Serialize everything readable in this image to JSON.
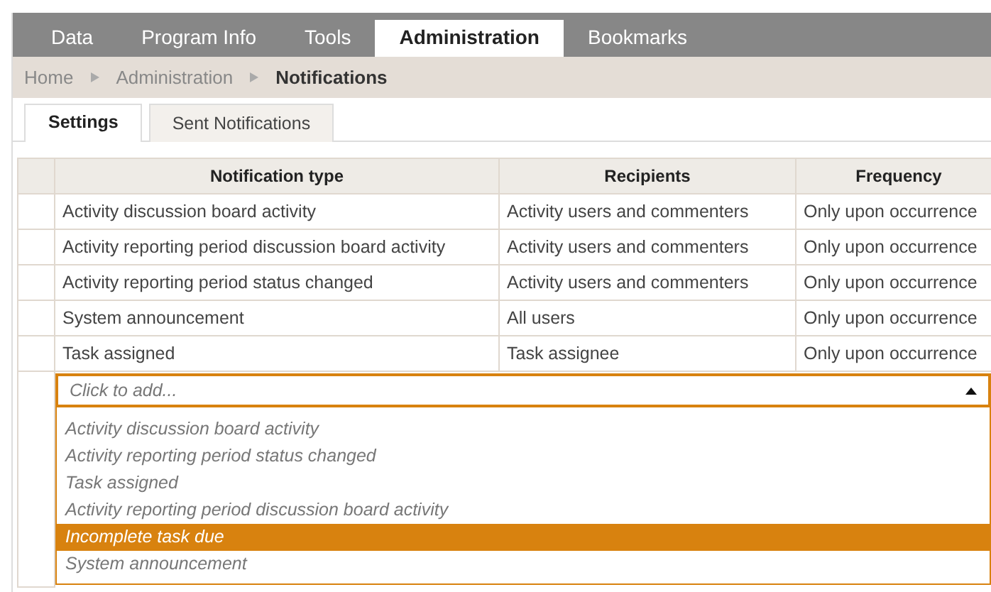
{
  "nav_tabs": [
    {
      "label": "Data",
      "selected": false
    },
    {
      "label": "Program Info",
      "selected": false
    },
    {
      "label": "Tools",
      "selected": false
    },
    {
      "label": "Administration",
      "selected": true
    },
    {
      "label": "Bookmarks",
      "selected": false
    }
  ],
  "breadcrumb": [
    {
      "label": "Home",
      "current": false
    },
    {
      "label": "Administration",
      "current": false
    },
    {
      "label": "Notifications",
      "current": true
    }
  ],
  "sub_tabs": [
    {
      "label": "Settings",
      "selected": true
    },
    {
      "label": "Sent Notifications",
      "selected": false
    }
  ],
  "table": {
    "columns": [
      "Notification type",
      "Recipients",
      "Frequency"
    ],
    "rows": [
      [
        "Activity discussion board activity",
        "Activity users and commenters",
        "Only upon occurrence"
      ],
      [
        "Activity reporting period discussion board activity",
        "Activity users and commenters",
        "Only upon occurrence"
      ],
      [
        "Activity reporting period status changed",
        "Activity users and commenters",
        "Only upon occurrence"
      ],
      [
        "System announcement",
        "All users",
        "Only upon occurrence"
      ],
      [
        "Task assigned",
        "Task assignee",
        "Only upon occurrence"
      ]
    ]
  },
  "add_dropdown": {
    "placeholder": "Click to add...",
    "expanded": true,
    "options": [
      {
        "label": "Activity discussion board activity",
        "selected": false
      },
      {
        "label": "Activity reporting period status changed",
        "selected": false
      },
      {
        "label": "Task assigned",
        "selected": false
      },
      {
        "label": "Activity reporting period discussion board activity",
        "selected": false
      },
      {
        "label": "Incomplete task due",
        "selected": true
      },
      {
        "label": "System announcement",
        "selected": false
      }
    ]
  }
}
